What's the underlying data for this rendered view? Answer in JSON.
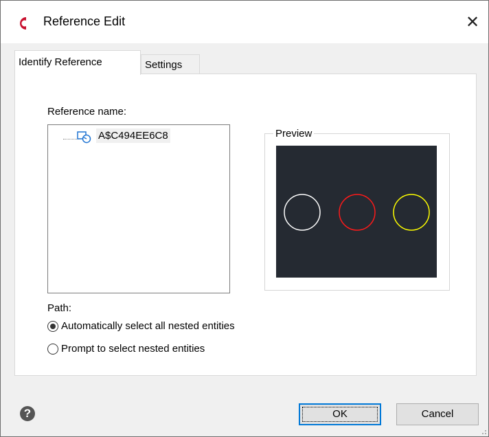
{
  "window": {
    "title": "Reference Edit",
    "close_glyph": "✕"
  },
  "tabs": [
    {
      "label": "Identify Reference",
      "active": true
    },
    {
      "label": "Settings",
      "active": false
    }
  ],
  "reference": {
    "label": "Reference name:",
    "items": [
      {
        "name": "A$C494EE6C8",
        "icon": "block-reference-icon",
        "selected": true
      }
    ]
  },
  "preview": {
    "label": "Preview",
    "background": "#252a32",
    "circles": [
      {
        "color": "#ffffff"
      },
      {
        "color": "#ff1a1a"
      },
      {
        "color": "#ffff00"
      }
    ]
  },
  "path": {
    "label": "Path:",
    "options": [
      {
        "label": "Automatically select all nested entities",
        "checked": true
      },
      {
        "label": "Prompt to select nested entities",
        "checked": false
      }
    ]
  },
  "footer": {
    "help_glyph": "?",
    "ok_label": "OK",
    "cancel_label": "Cancel"
  },
  "colors": {
    "accent": "#0078d7",
    "logo": "#c8102e"
  }
}
